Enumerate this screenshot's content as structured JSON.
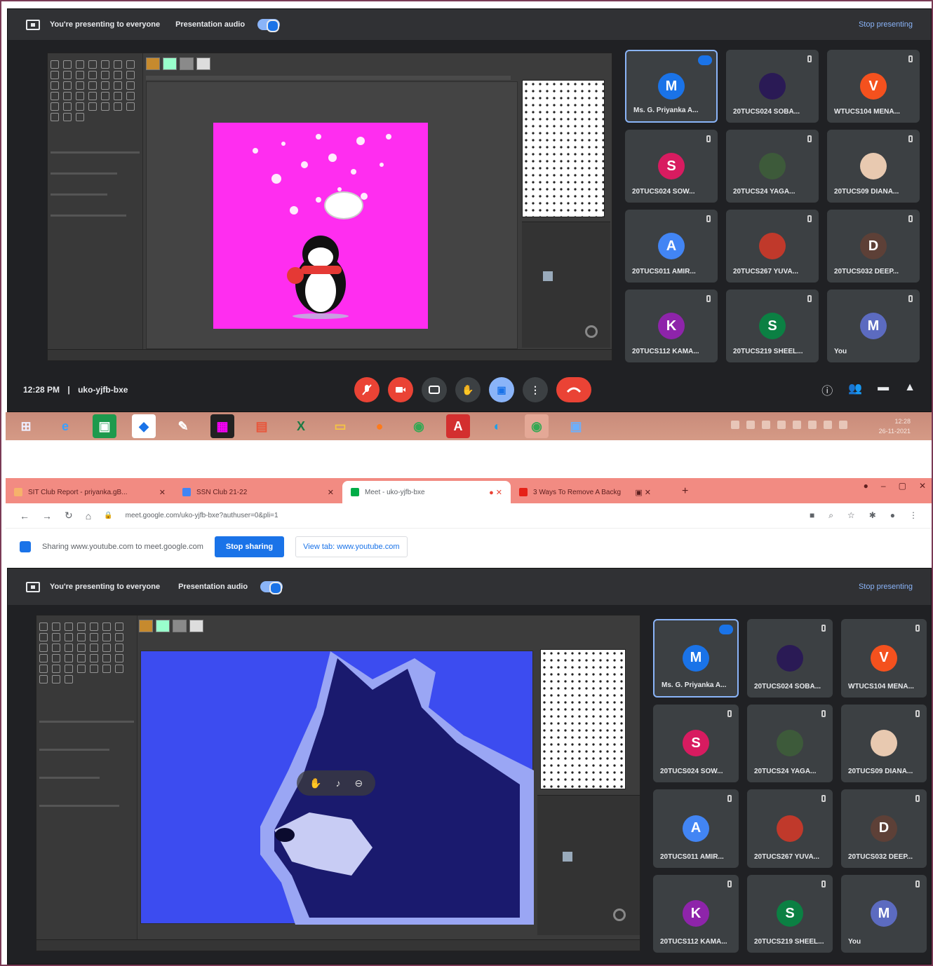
{
  "colors": {
    "meet_bg": "#202124",
    "tile_bg": "#3c4043",
    "accent": "#8ab4f8",
    "danger": "#ea4335",
    "magenta_canvas": "#ff2df0",
    "blue_canvas": "#3c4cf0"
  },
  "meet_top": {
    "presenting_text": "You're presenting to everyone",
    "audio_label": "Presentation audio",
    "stop_presenting": "Stop presenting",
    "clock": "12:28 PM",
    "separator": "|",
    "meeting_code": "uko-yjfb-bxe"
  },
  "meet_bottom": {
    "presenting_text": "You're presenting to everyone",
    "audio_label": "Presentation audio",
    "stop_presenting": "Stop presenting"
  },
  "participants": [
    {
      "initial": "M",
      "name": "Ms. G. Priyanka A...",
      "color": "#1a73e8",
      "active": true
    },
    {
      "initial": "",
      "name": "20TUCS024 SOBA...",
      "color": "#2a1a55",
      "photo": true
    },
    {
      "initial": "V",
      "name": "WTUCS104 MENA...",
      "color": "#f4511e"
    },
    {
      "initial": "S",
      "name": "20TUCS024 SOW...",
      "color": "#d81b60"
    },
    {
      "initial": "",
      "name": "20TUCS24 YAGA...",
      "color": "#3d5a3a",
      "photo": true
    },
    {
      "initial": "",
      "name": "20TUCS09 DIANA...",
      "color": "#e8c9b0",
      "photo": true
    },
    {
      "initial": "A",
      "name": "20TUCS011 AMIR...",
      "color": "#4285f4"
    },
    {
      "initial": "",
      "name": "20TUCS267 YUVA...",
      "color": "#c0392b",
      "photo": true
    },
    {
      "initial": "D",
      "name": "20TUCS032 DEEP...",
      "color": "#5d4037"
    },
    {
      "initial": "K",
      "name": "20TUCS112 KAMA...",
      "color": "#8e24aa"
    },
    {
      "initial": "S",
      "name": "20TUCS219 SHEEL...",
      "color": "#0b8043"
    },
    {
      "initial": "M",
      "name": "You",
      "color": "#5c6bc0"
    }
  ],
  "controls": {
    "mic": "mic-off",
    "cam": "cam-off",
    "cc": "CC",
    "hand": "✋",
    "present": "▣",
    "more": "⋮",
    "hangup": "☎"
  },
  "taskbar": {
    "apps": [
      "start",
      "ie",
      "calc",
      "dropbox",
      "tools",
      "paint",
      "office",
      "excel",
      "explorer",
      "firefox",
      "chrome",
      "acrobat",
      "edge",
      "chrome2",
      "photos"
    ],
    "time": "12:28",
    "date": "26-11-2021"
  },
  "browser": {
    "tabs": [
      {
        "title": "SIT Club Report - priyanka.gB...",
        "active": false
      },
      {
        "title": "SSN Club 21-22",
        "active": false
      },
      {
        "title": "Meet - uko-yjfb-bxe",
        "active": true
      },
      {
        "title": "3 Ways To Remove A Backg",
        "active": false
      }
    ],
    "url": "meet.google.com/uko-yjfb-bxe?authuser=0&pli=1",
    "sharing_text": "Sharing www.youtube.com to meet.google.com",
    "stop_sharing": "Stop sharing",
    "view_tab": "View tab: www.youtube.com"
  }
}
